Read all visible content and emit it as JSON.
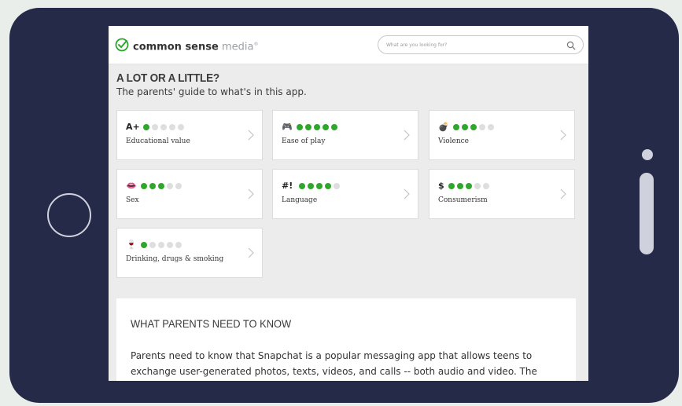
{
  "header": {
    "brand_bold": "common sense",
    "brand_light": "media",
    "brand_mark": "®",
    "search_placeholder": "What are you looking for?"
  },
  "page": {
    "title": "A LOT OR A LITTLE?",
    "subtitle": "The parents' guide to what's in this app."
  },
  "ratings": [
    {
      "symbol": "A+",
      "label": "Educational value",
      "score": 1,
      "max": 5
    },
    {
      "symbol": "🎮",
      "label": "Ease of play",
      "score": 5,
      "max": 5
    },
    {
      "symbol": "💣",
      "label": "Violence",
      "score": 3,
      "max": 5
    },
    {
      "symbol": "👄",
      "label": "Sex",
      "score": 3,
      "max": 5
    },
    {
      "symbol": "#!",
      "label": "Language",
      "score": 4,
      "max": 5
    },
    {
      "symbol": "$",
      "label": "Consumerism",
      "score": 3,
      "max": 5
    },
    {
      "symbol": "🍷",
      "label": "Drinking, drugs & smoking",
      "score": 1,
      "max": 5
    }
  ],
  "info": {
    "title": "WHAT PARENTS NEED TO KNOW",
    "body": "Parents need to know that Snapchat is a popular messaging app that allows teens to exchange user-generated photos, texts, videos, and calls -- both audio and video. The"
  },
  "colors": {
    "accent": "#2fa62c",
    "device": "#262a49",
    "background": "#e9eeea"
  }
}
